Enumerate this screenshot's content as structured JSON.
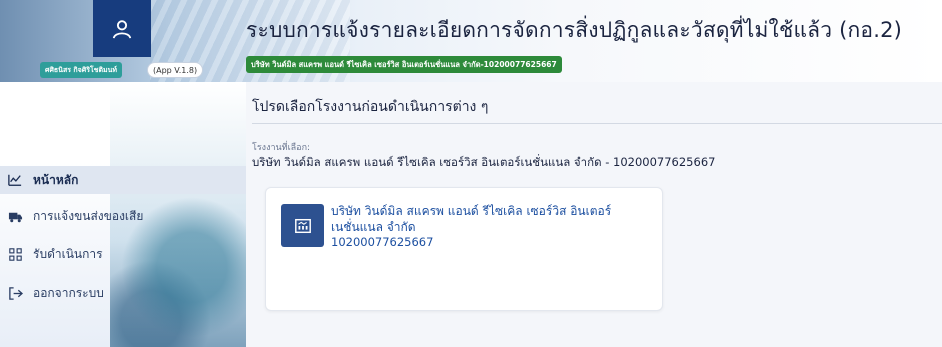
{
  "header": {
    "title": "ระบบการแจ้งรายละเอียดการจัดการสิ่งปฏิกูลและวัสดุที่ไม่ใช้แล้ว (กอ.2)",
    "company_chip": "บริษัท วินด์มิล สแครพ แอนด์ รีไซเคิล เซอร์วิส อินเตอร์เนชั่นแนล จำกัด-10200077625667"
  },
  "user": {
    "name": "ศศิธนิสร กิจศิริโชติมนท์",
    "app_version": "(App V.1.8)"
  },
  "sidebar": {
    "items": [
      {
        "label": "หน้าหลัก",
        "icon": "chart-line-icon",
        "active": true
      },
      {
        "label": "การแจ้งขนส่งของเสีย",
        "icon": "truck-icon",
        "active": false
      },
      {
        "label": "รับดำเนินการ",
        "icon": "grid-icon",
        "active": false
      },
      {
        "label": "ออกจากระบบ",
        "icon": "logout-icon",
        "active": false
      }
    ]
  },
  "main": {
    "section_title": "โปรดเลือกโรงงานก่อนดำเนินการต่าง ๆ",
    "selected_label": "โรงงานที่เลือก:",
    "selected_value": "บริษัท วินด์มิล สแครพ แอนด์ รีไซเคิล เซอร์วิส อินเตอร์เนชั่นแนล จำกัด - 10200077625667",
    "factory_card": {
      "name": "บริษัท วินด์มิล สแครพ แอนด์ รีไซเคิล เซอร์วิส อินเตอร์เนชั่นแนล จำกัด",
      "code": "10200077625667",
      "icon": "factory-icon"
    }
  },
  "colors": {
    "primary_dark": "#173c7e",
    "company_chip": "#2d8a3a",
    "user_pill": "#2e9e9a",
    "link_blue": "#1c4fa0"
  }
}
